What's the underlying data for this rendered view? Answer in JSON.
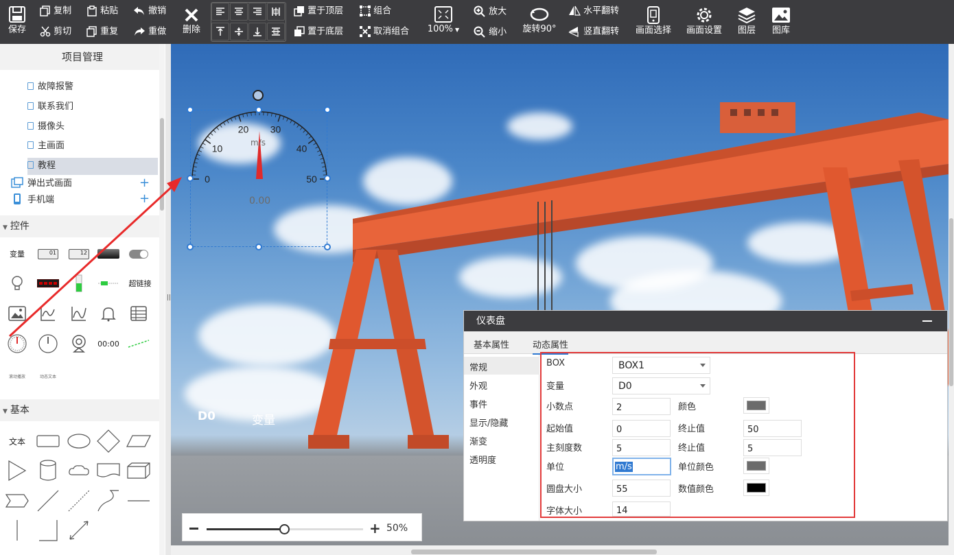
{
  "toolbar": {
    "save": "保存",
    "copy": "复制",
    "cut": "剪切",
    "paste": "粘贴",
    "repeat": "重复",
    "undo": "撤销",
    "redo": "重做",
    "delete": "删除",
    "bring_top": "置于顶层",
    "send_bottom": "置于底层",
    "group": "组合",
    "ungroup": "取消组合",
    "zoom_level": "100%",
    "zoom_in": "放大",
    "zoom_out": "缩小",
    "rotate": "旋转90°",
    "flip_h": "水平翻转",
    "flip_v": "竖直翻转",
    "screen_select": "画面选择",
    "screen_settings": "画面设置",
    "layers": "图层",
    "gallery": "图库"
  },
  "left_panel": {
    "title": "项目管理",
    "tree": [
      "故障报警",
      "联系我们",
      "摄像头",
      "主画面",
      "教程"
    ],
    "popup_screens": "弹出式画面",
    "mobile": "手机端",
    "controls_header": "控件",
    "controls": {
      "variable": "变量",
      "num1": "01",
      "num2": "12",
      "hyperlink": "超链接",
      "clock": "00:00",
      "small1": "滚动播放",
      "small2": "动态文本"
    },
    "basic_header": "基本",
    "basic_text": "文本"
  },
  "canvas": {
    "gauge": {
      "unit": "m/s",
      "value": "0.00",
      "ticks": [
        "0",
        "10",
        "20",
        "30",
        "40",
        "50"
      ],
      "min": 0,
      "max": 50,
      "current": 0
    },
    "label_d0": "D0",
    "label_var": "变量"
  },
  "zoom": {
    "value": "50%",
    "fraction": 0.5,
    "minus": "−",
    "plus": "+"
  },
  "dialog": {
    "title": "仪表盘",
    "minimize": "—",
    "tabs": [
      "基本属性",
      "动态属性"
    ],
    "active_tab": "动态属性",
    "nav": [
      "常规",
      "外观",
      "事件",
      "显示/隐藏",
      "渐变",
      "透明度"
    ],
    "props": {
      "box_label": "BOX",
      "box_value": "BOX1",
      "var_label": "变量",
      "var_value": "D0",
      "decimal_label": "小数点",
      "decimal_value": "2",
      "color_label": "颜色",
      "start_label": "起始值",
      "start_value": "0",
      "end_label": "终止值",
      "end_value": "50",
      "major_label": "主刻度数",
      "major_value": "5",
      "end2_label": "终止值",
      "end2_value": "5",
      "unit_label": "单位",
      "unit_value": "m/s",
      "unit_color_label": "单位颜色",
      "dial_size_label": "圆盘大小",
      "dial_size_value": "55",
      "value_color_label": "数值颜色",
      "font_size_label": "字体大小",
      "font_size_value": "14"
    },
    "colors": {
      "color": "#6b6b6b",
      "unit_color": "#6b6b6b",
      "value_color": "#000000"
    }
  }
}
